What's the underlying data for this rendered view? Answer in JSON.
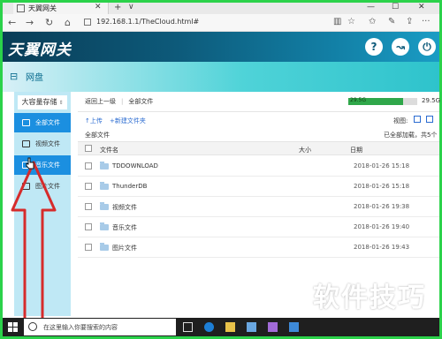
{
  "browser": {
    "tab_title": "天翼网关",
    "tab_close": "✕",
    "new_tab": "+",
    "tab_menu": "∨",
    "window_minimize": "—",
    "window_maximize": "☐",
    "window_close": "✕",
    "address": "192.168.1.1/TheCloud.html#",
    "nav": {
      "back": "←",
      "forward": "→",
      "refresh": "↻",
      "home": "⌂"
    },
    "tools": {
      "reading_view": "▥",
      "favorite": "☆",
      "favorites_list": "✩",
      "notes": "✎",
      "share": "⇪",
      "more": "···"
    }
  },
  "header": {
    "logo": "天翼网关",
    "help_icon": "?",
    "connect_icon": "↝",
    "power_icon": "⏻"
  },
  "banner": {
    "icon": "⊟",
    "title": "网盘"
  },
  "sidebar": {
    "storage_title": "大容量存储",
    "storage_chevron": "⇕",
    "items": [
      {
        "label": "全部文件",
        "icon": "all-files-icon",
        "active": true
      },
      {
        "label": "视频文件",
        "icon": "video-files-icon",
        "active": false
      },
      {
        "label": "音乐文件",
        "icon": "music-files-icon",
        "active": true
      },
      {
        "label": "图片文件",
        "icon": "image-files-icon",
        "active": false
      }
    ]
  },
  "main": {
    "breadcrumb": {
      "back": "返回上一级",
      "separator": "|",
      "current": "全部文件"
    },
    "storage": {
      "used_label": "29.5G",
      "total_label": "29.5G",
      "used_fraction": 0.8
    },
    "actions": {
      "upload": "上传",
      "new_folder": "新建文件夹"
    },
    "view_label": "视图:",
    "section_title": "全部文件",
    "load_status": "已全部加载，共5个",
    "columns": {
      "name": "文件名",
      "size": "大小",
      "date": "日期"
    },
    "rows": [
      {
        "name": "TDDOWNLOAD",
        "date": "2018-01-26 15:18"
      },
      {
        "name": "ThunderDB",
        "date": "2018-01-26 15:18"
      },
      {
        "name": "视频文件",
        "date": "2018-01-26 19:38"
      },
      {
        "name": "音乐文件",
        "date": "2018-01-26 19:40"
      },
      {
        "name": "图片文件",
        "date": "2018-01-26 19:43"
      }
    ]
  },
  "watermark": "软件技巧",
  "taskbar": {
    "search_placeholder": "在这里输入你要搜索的内容"
  },
  "colors": {
    "frame": "#2bd24a",
    "active_item": "#1b8fe0",
    "arrow": "#d62b2b",
    "progress": "#2fa74a"
  }
}
